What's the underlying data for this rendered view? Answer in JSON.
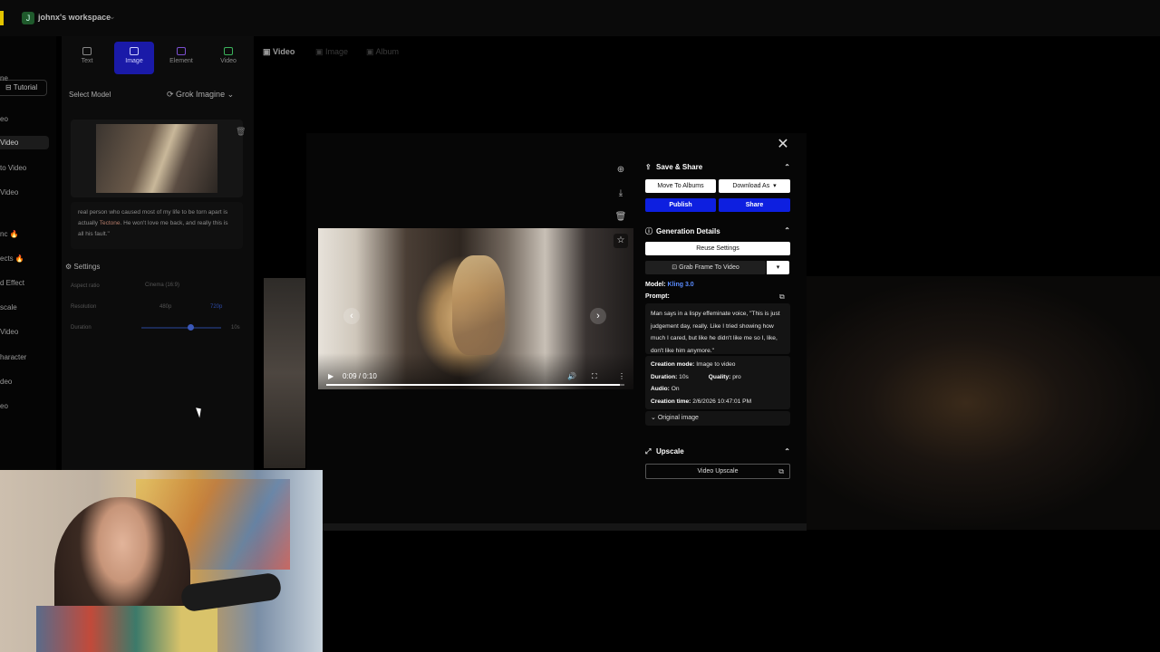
{
  "workspace": {
    "badge": "J",
    "name": "johnx's workspace"
  },
  "sidebar": {
    "tutorial": "Tutorial",
    "items": [
      {
        "label": "ne"
      },
      {
        "label": "eo"
      },
      {
        "label": "Video"
      },
      {
        "label": "to Video"
      },
      {
        "label": "Video"
      },
      {
        "label": "nc 🔥"
      },
      {
        "label": "ects 🔥"
      },
      {
        "label": "d Effect"
      },
      {
        "label": "scale"
      },
      {
        "label": "Video"
      },
      {
        "label": "haracter"
      },
      {
        "label": "deo"
      },
      {
        "label": "eo"
      }
    ]
  },
  "tools": {
    "tabs": [
      {
        "label": "Text"
      },
      {
        "label": "Image"
      },
      {
        "label": "Element"
      },
      {
        "label": "Video"
      }
    ],
    "select_model_label": "Select Model",
    "model_value": "Grok Imagine",
    "prompt_text_a": "real person who caused most of my life to be torn apart is actually ",
    "prompt_highlight": "Tectone",
    "prompt_text_b": ". He won't love me back, and really this is all his fault.\"",
    "settings_label": "Settings",
    "aspect_ratio_label": "Aspect ratio",
    "aspect_ratio_value": "Cinema (16:9)",
    "resolution_label": "Resolution",
    "res_a": "480p",
    "res_b": "720p",
    "duration_label": "Duration",
    "duration_value": "10s",
    "duration_fraction": 0.6
  },
  "main_tabs": [
    {
      "label": "Video"
    },
    {
      "label": "Image"
    },
    {
      "label": "Album"
    }
  ],
  "player": {
    "time": "0:09 / 0:10",
    "progress_fraction": 0.985
  },
  "panel": {
    "save_share": {
      "title": "Save & Share",
      "move_to_albums": "Move To Albums",
      "download_as": "Download As",
      "publish": "Publish",
      "share": "Share"
    },
    "generation": {
      "title": "Generation Details",
      "reuse_settings": "Reuse Settings",
      "grab_frame": "Grab Frame To Video",
      "model_label": "Model:",
      "model_value": "Kling 3.0",
      "prompt_label": "Prompt:",
      "prompt": "Man says in a lispy effeminate voice, \"This is just judgement day, really. Like I tried showing how much I cared, but like he didn't like me so I, like, don't like him anymore.\"",
      "creation_mode_label": "Creation mode:",
      "creation_mode": "Image to video",
      "duration_label": "Duration:",
      "duration": "10s",
      "quality_label": "Quality:",
      "quality": "pro",
      "audio_label": "Audio:",
      "audio": "On",
      "creation_time_label": "Creation time:",
      "creation_time": "2/6/2026 10:47:01 PM",
      "original_image": "Original image"
    },
    "upscale": {
      "title": "Upscale",
      "video_upscale": "Video Upscale"
    }
  }
}
